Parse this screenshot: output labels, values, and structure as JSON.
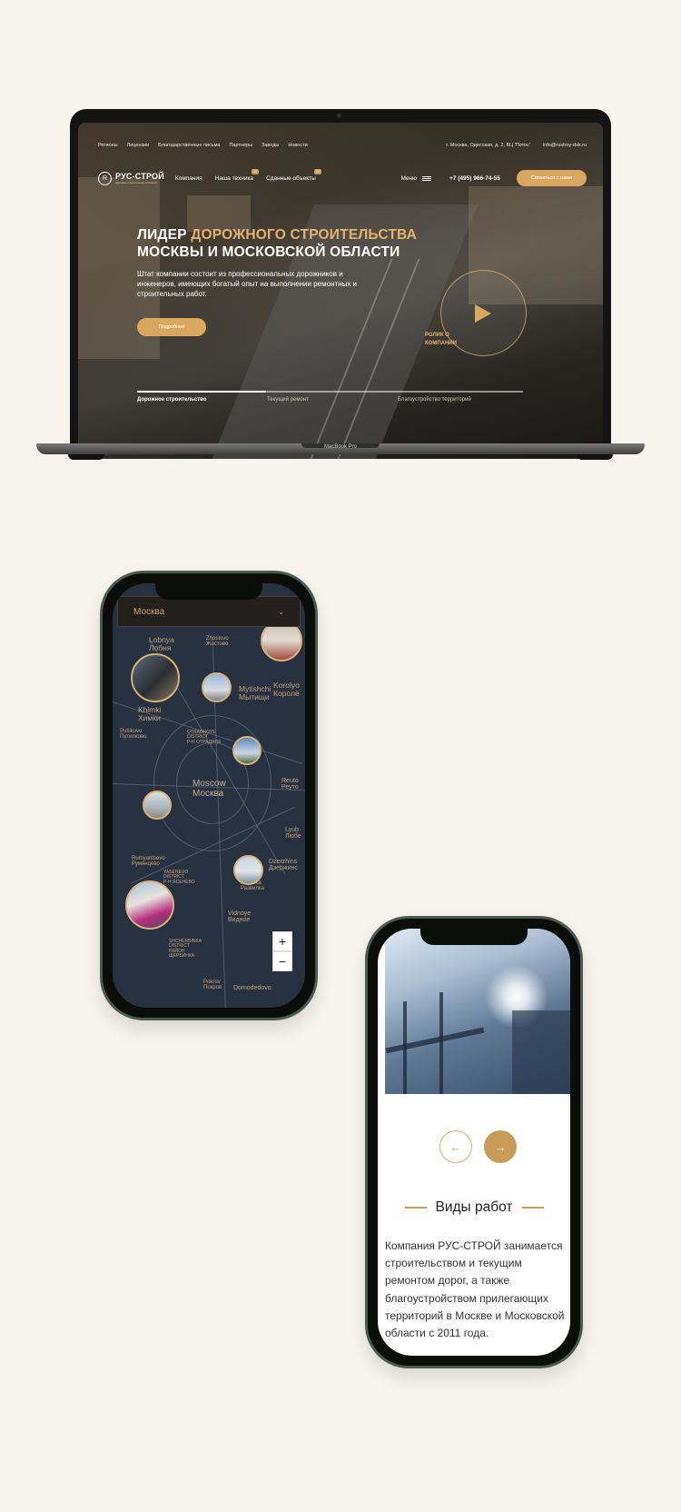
{
  "laptop": {
    "top_nav": [
      "Регионы",
      "Лицензии",
      "Благодарственные письма",
      "Партнеры",
      "Заводы",
      "Новости"
    ],
    "address": "г. Москва, Одесская, д. 2, БЦ 'Потос'",
    "email": "info@rustroy-dsk.ru",
    "logo": {
      "mark": "R",
      "name": "РУС-СТРОЙ",
      "tagline": "дорожно-строительная компания"
    },
    "main_nav": [
      {
        "label": "Компания",
        "badge": ""
      },
      {
        "label": "Наша техника",
        "badge": "20"
      },
      {
        "label": "Сданные объекты",
        "badge": "20"
      }
    ],
    "menu_label": "Меню",
    "phone": "+7 (495) 966-74-55",
    "cta_label": "Связаться с нами",
    "hero": {
      "title_line1_white": "ЛИДЕР ",
      "title_line1_gold": "ДОРОЖНОГО СТРОИТЕЛЬСТВА",
      "title_line2": "МОСКВЫ И МОСКОВСКОЙ ОБЛАСТИ",
      "text": "Штат компании состоит из профессиональных дорожников и инженеров, имеющих богатый опыт на выполнении ремонтных и строительных работ.",
      "button": "Подробнее",
      "video_label": "РОЛИК О КОМПАНИИ"
    },
    "tabs": [
      "Дорожное строительство",
      "Текущий ремонт",
      "Благоустройство территорий"
    ],
    "device_label": "MacBook Pro"
  },
  "map_phone": {
    "city_select": "Москва",
    "map_labels": [
      {
        "text": "Lobnya\nЛобня"
      },
      {
        "text": "Zhostovo\nЖостово"
      },
      {
        "text": "Mytishchi\nМытищи"
      },
      {
        "text": "Korolyo\nКоролё"
      },
      {
        "text": "Khimki\nХимки"
      },
      {
        "text": "Putilkovo\nПутилково"
      },
      {
        "text": "OTRADNOYE\nDISTRICT\nР-Н ОТРАДНОЕ"
      },
      {
        "text": "Moscow\nМосква"
      },
      {
        "text": "Reuto\nРеуто"
      },
      {
        "text": "Lyub\nЛюбе"
      },
      {
        "text": "Rumyantsevo\nРумянцево"
      },
      {
        "text": "YASENEVO\nDISTRICT\nР-Н ЯСЕНЕВО"
      },
      {
        "text": "Dzerzhins\nДзержинс"
      },
      {
        "text": "Razvilka\nРазвилка"
      },
      {
        "text": "Vidnoye\nВидное"
      },
      {
        "text": "SHCHERBINKA\nDISTRICT\nРАЙОН\nЩЕРБИНКА"
      },
      {
        "text": "Pokrov\nПокров"
      },
      {
        "text": "Domodedovo"
      }
    ],
    "zoom_in": "+",
    "zoom_out": "−"
  },
  "content_phone": {
    "prev_arrow": "←",
    "next_arrow": "→",
    "section_title": "Виды работ",
    "section_text": "Компания РУС-СТРОЙ занимается строительством и текущим ремонтом дорог, а также благоустройством прилегающих территорий в Москве и Московской области с 2011 года."
  },
  "colors": {
    "accent_gold": "#d9a760",
    "background": "#f7f3ee",
    "map_bg": "#283140"
  }
}
